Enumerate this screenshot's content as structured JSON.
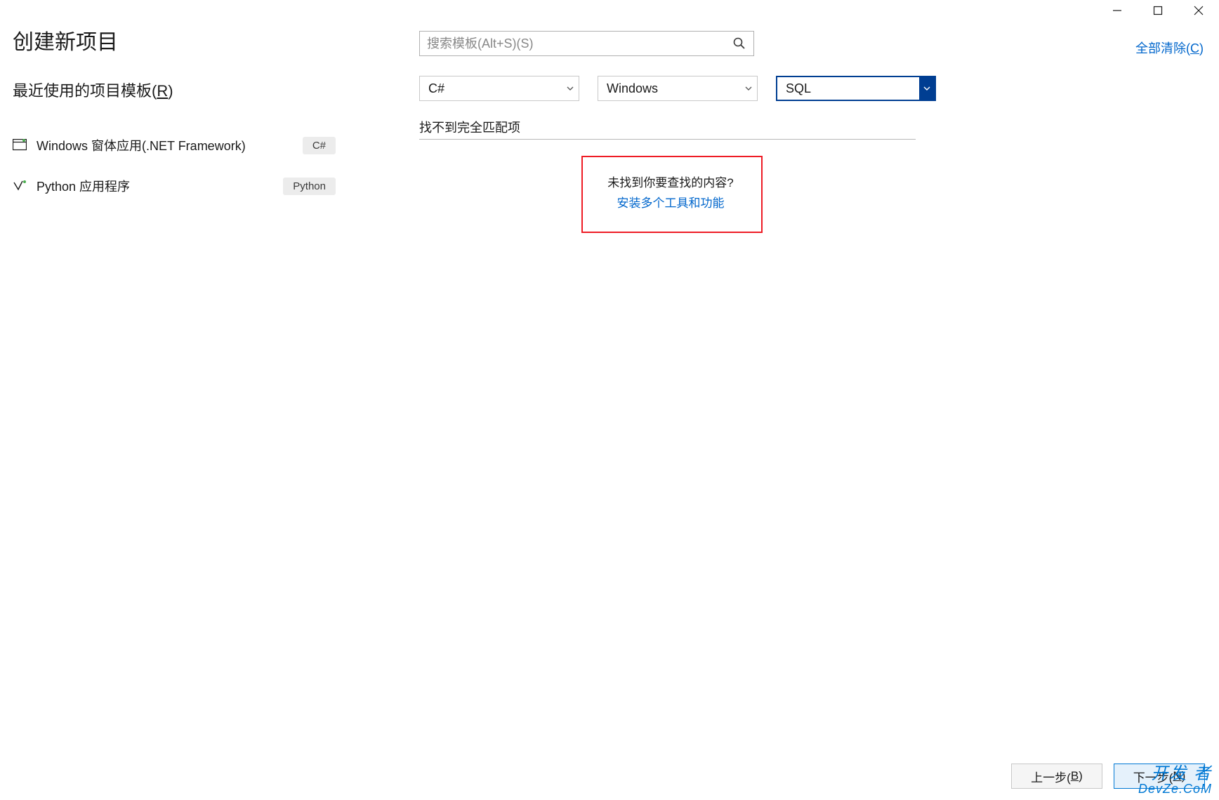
{
  "titlebar": {
    "minimize": "minimize",
    "maximize": "maximize",
    "close": "close"
  },
  "header": {
    "title": "创建新项目",
    "subtitle_prefix": "最近使用的项目模板(",
    "subtitle_key": "R",
    "subtitle_suffix": ")"
  },
  "recent": [
    {
      "label": "Windows 窗体应用(.NET Framework)",
      "tag": "C#",
      "icon": "winforms"
    },
    {
      "label": "Python 应用程序",
      "tag": "Python",
      "icon": "python"
    }
  ],
  "search": {
    "placeholder": "搜索模板(Alt+S)(S)"
  },
  "clear_all": "全部清除(C)",
  "clear_all_prefix": "全部清除(",
  "clear_all_key": "C",
  "clear_all_suffix": ")",
  "filters": {
    "language": "C#",
    "platform": "Windows",
    "project_type": "SQL"
  },
  "results": {
    "no_match": "找不到完全匹配项",
    "not_found_text": "未找到你要查找的内容?",
    "install_link": "安装多个工具和功能"
  },
  "footer": {
    "back_prefix": "上一步(",
    "back_key": "B",
    "back_suffix": ")",
    "next_prefix": "下一步(",
    "next_key": "N",
    "next_suffix": ")"
  },
  "watermark": {
    "line1": "开发 者",
    "line2": "DevZe.CoM"
  }
}
